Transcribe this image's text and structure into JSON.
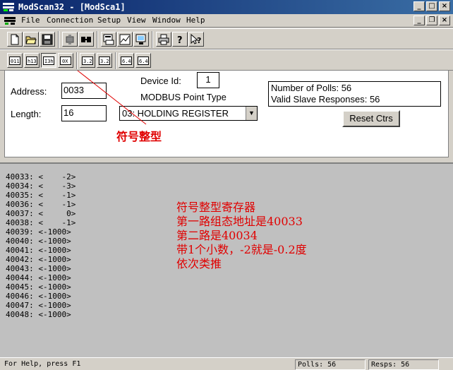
{
  "window": {
    "title": "ModScan32 - [ModSca1]",
    "minimize": "_",
    "maximize": "□",
    "close": "×"
  },
  "menu": {
    "items": [
      "File",
      "Connection",
      "Setup",
      "View",
      "Window",
      "Help"
    ],
    "mdi_minimize": "_",
    "mdi_restore": "❐",
    "mdi_close": "×"
  },
  "toolbar1": {
    "icons": [
      "new-file-icon",
      "open-folder-icon",
      "save-icon",
      "connect-icon",
      "disconnect-icon",
      "display-options-icon",
      "chart-icon",
      "monitor-icon",
      "print-icon",
      "about-icon",
      "context-help-icon"
    ]
  },
  "toolbar2": {
    "labels": [
      "011",
      "h13",
      "I3h",
      "0X",
      "3.2",
      "3.2",
      "6.4",
      "6.4"
    ]
  },
  "config": {
    "device_id_label": "Device Id:",
    "device_id_value": "1",
    "point_type_label": "MODBUS Point Type",
    "address_label": "Address:",
    "address_value": "0033",
    "length_label": "Length:",
    "length_value": "16",
    "point_type_value": "03: HOLDING REGISTER",
    "polls_text": "Number of Polls: 56",
    "responses_text": "Valid Slave Responses: 56",
    "reset_label": "Reset Ctrs",
    "annotation_small": "符号整型"
  },
  "registers": [
    "40033: <    -2>",
    "40034: <    -3>",
    "40035: <    -1>",
    "40036: <    -1>",
    "40037: <     0>",
    "40038: <    -1>",
    "40039: <-1000>",
    "40040: <-1000>",
    "40041: <-1000>",
    "40042: <-1000>",
    "40043: <-1000>",
    "40044: <-1000>",
    "40045: <-1000>",
    "40046: <-1000>",
    "40047: <-1000>",
    "40048: <-1000>"
  ],
  "annotation": [
    "符号整型寄存器",
    "第一路组态地址是40033",
    "第二路是40034",
    "带1个小数，-2就是-0.2度",
    "依次类推"
  ],
  "status": {
    "help": "For Help, press F1",
    "polls": "Polls: 56",
    "resps": "Resps: 56"
  },
  "colors": {
    "title_bar": "#0a246a",
    "annotation_red": "#e00000",
    "panel_gray": "#c0c0c0"
  }
}
